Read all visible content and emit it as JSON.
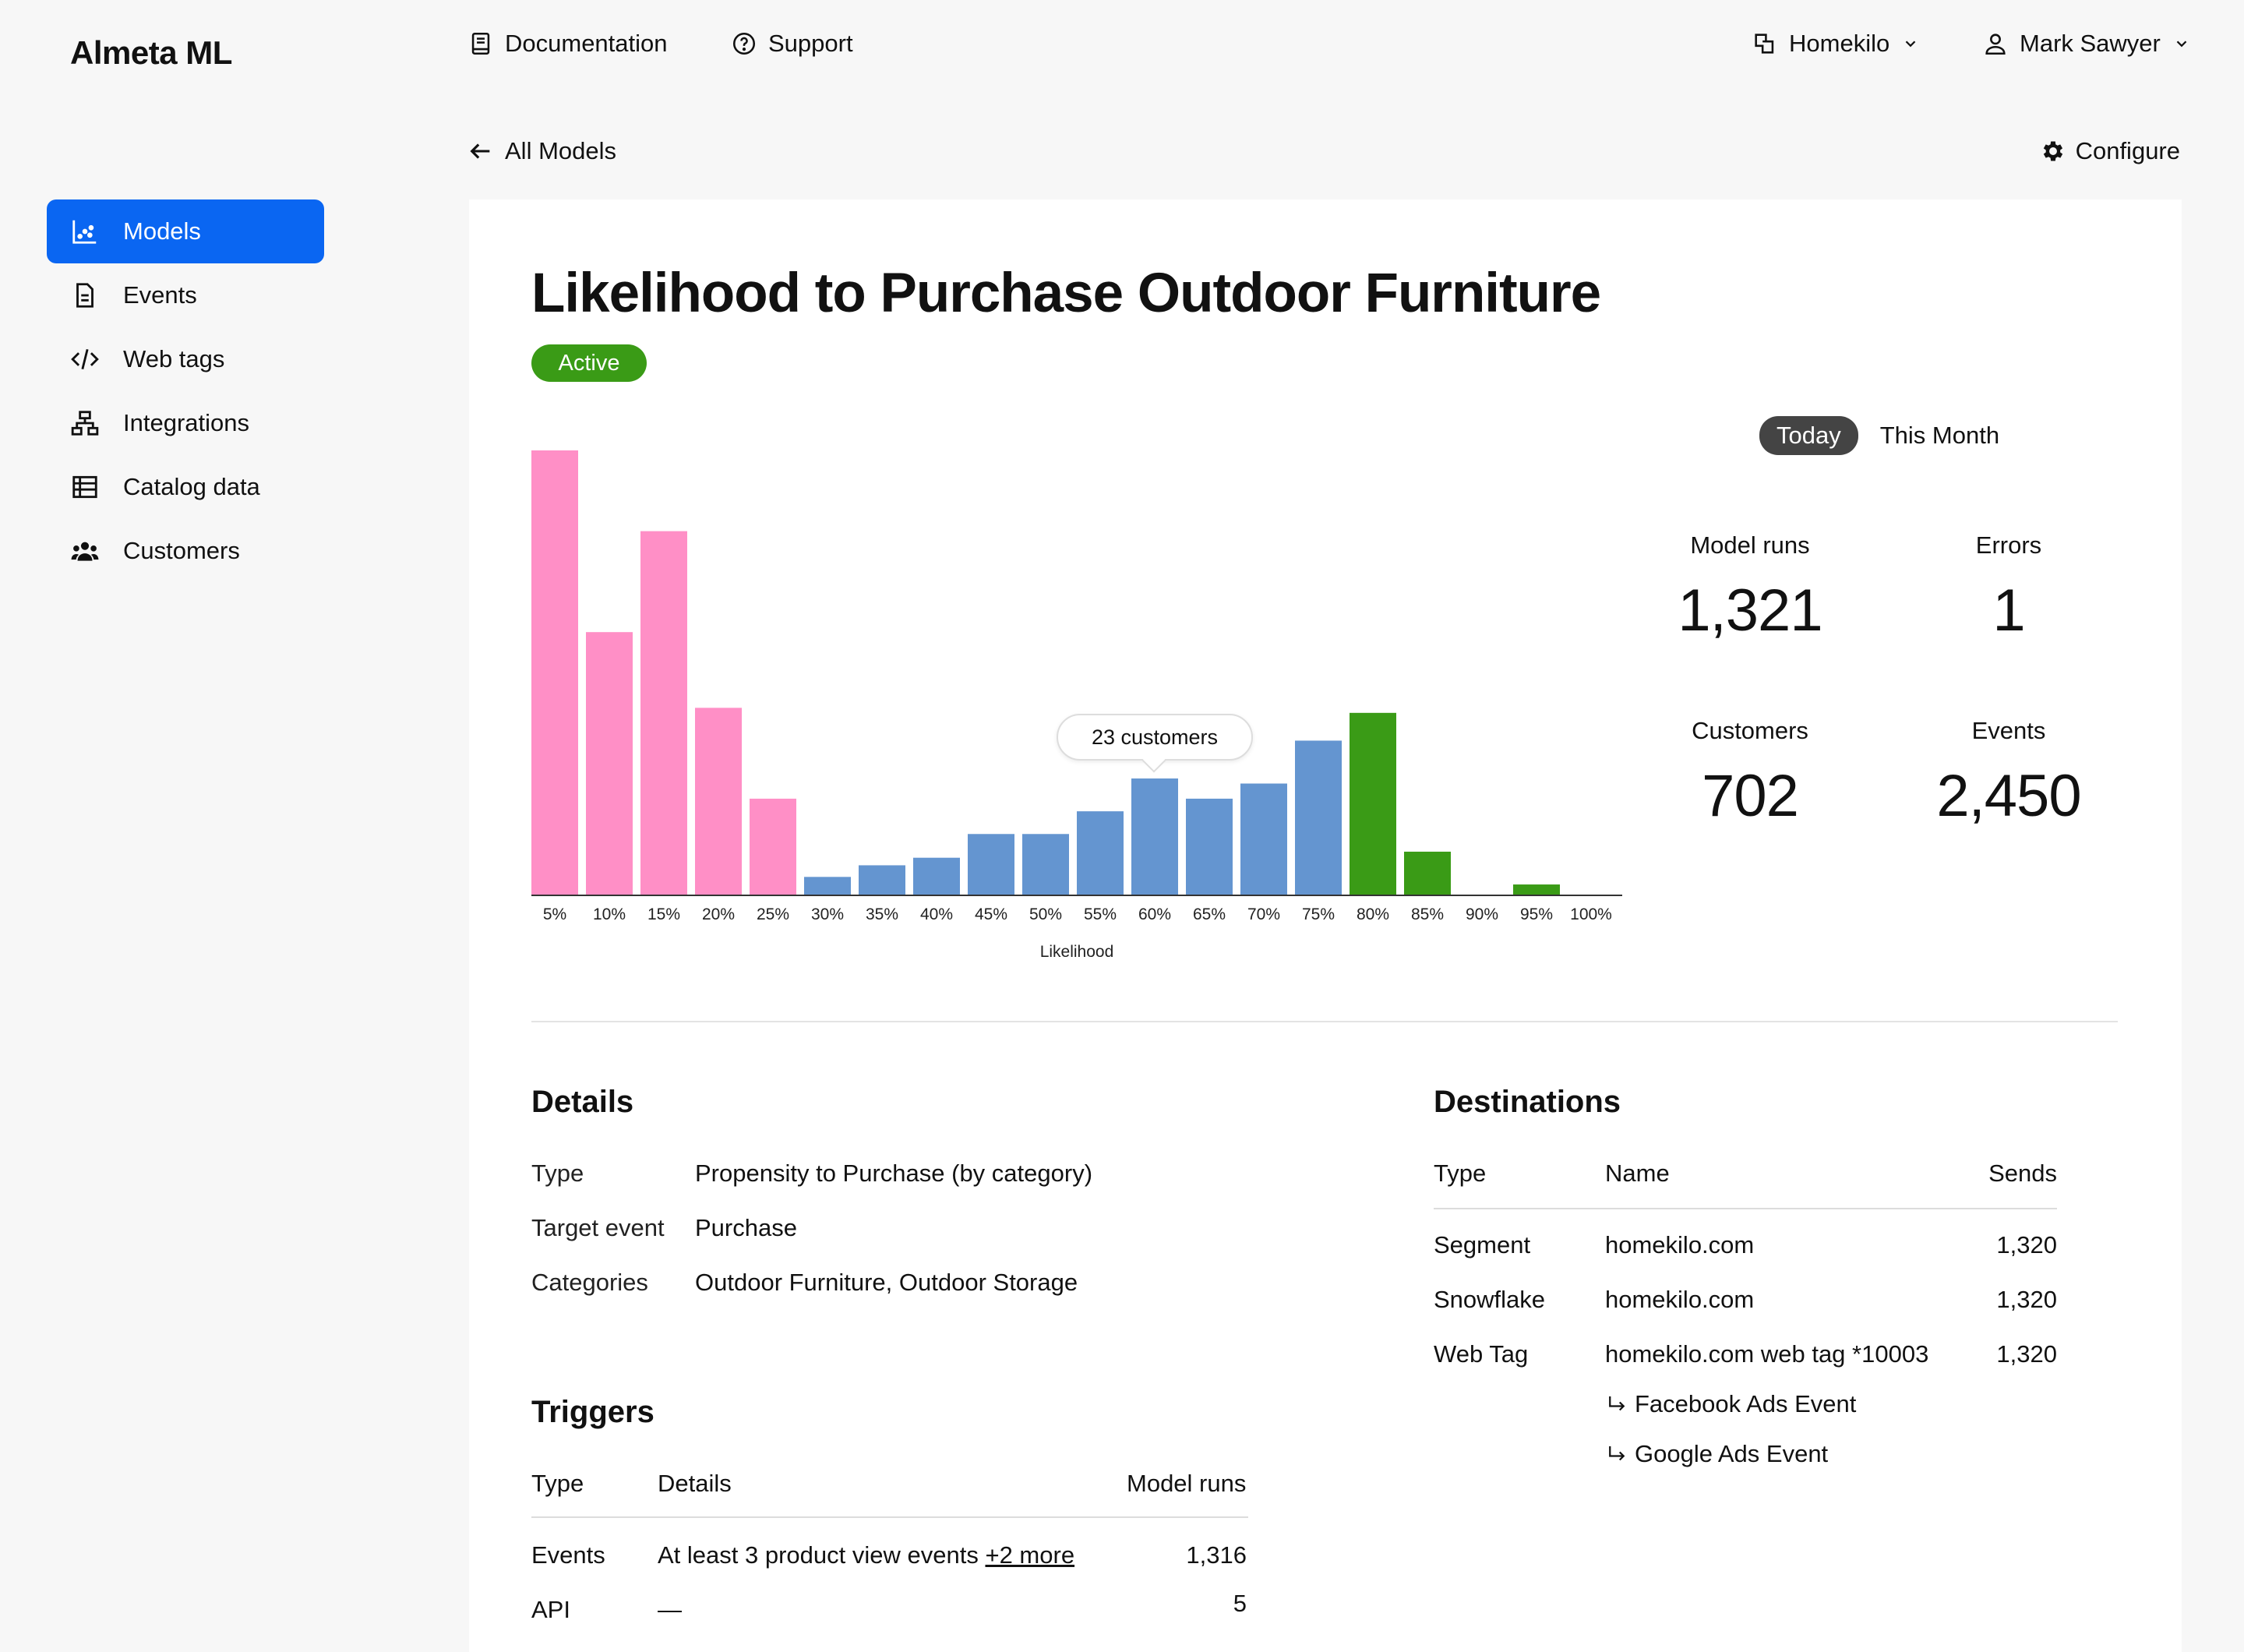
{
  "app": {
    "title": "Almeta ML"
  },
  "topnav": {
    "documentation": "Documentation",
    "support": "Support",
    "workspace": "Homekilo",
    "user": "Mark Sawyer"
  },
  "sidebar": {
    "items": [
      {
        "label": "Models",
        "icon": "chart-icon",
        "active": true
      },
      {
        "label": "Events",
        "icon": "document-icon"
      },
      {
        "label": "Web tags",
        "icon": "code-icon"
      },
      {
        "label": "Integrations",
        "icon": "network-icon"
      },
      {
        "label": "Catalog data",
        "icon": "table-icon"
      },
      {
        "label": "Customers",
        "icon": "users-icon"
      }
    ]
  },
  "header": {
    "back_label": "All Models",
    "configure_label": "Configure"
  },
  "model": {
    "title": "Likelihood to Purchase Outdoor Furniture",
    "status": "Active"
  },
  "colors": {
    "accent": "#0a66f2",
    "active": "#3a9b16",
    "pink": "#ff8fc6",
    "blue": "#6495d0",
    "green": "#3a9b16"
  },
  "chart_data": {
    "type": "bar",
    "xlabel": "Likelihood",
    "categories": [
      "5%",
      "10%",
      "15%",
      "20%",
      "25%",
      "30%",
      "35%",
      "40%",
      "45%",
      "50%",
      "55%",
      "60%",
      "65%",
      "70%",
      "75%",
      "80%",
      "85%",
      "90%",
      "95%",
      "100%"
    ],
    "values": [
      88,
      52,
      72,
      37,
      19,
      3.5,
      5.8,
      7.3,
      12,
      12,
      16.5,
      23,
      19,
      22,
      30.5,
      36,
      8.5,
      0,
      2,
      0
    ],
    "bar_groups": [
      "pink",
      "pink",
      "pink",
      "pink",
      "pink",
      "blue",
      "blue",
      "blue",
      "blue",
      "blue",
      "blue",
      "blue",
      "blue",
      "blue",
      "blue",
      "green",
      "green",
      "green",
      "green",
      "green"
    ],
    "tooltip": {
      "category": "60%",
      "label": "23 customers"
    }
  },
  "period": {
    "today": "Today",
    "month": "This Month"
  },
  "stats": {
    "model_runs_label": "Model runs",
    "model_runs": "1,321",
    "errors_label": "Errors",
    "errors": "1",
    "customers_label": "Customers",
    "customers": "702",
    "events_label": "Events",
    "events": "2,450"
  },
  "details": {
    "heading": "Details",
    "rows": [
      {
        "label": "Type",
        "value": "Propensity to Purchase (by category)"
      },
      {
        "label": "Target event",
        "value": "Purchase"
      },
      {
        "label": "Categories",
        "value": "Outdoor Furniture, Outdoor Storage"
      }
    ]
  },
  "triggers": {
    "heading": "Triggers",
    "columns": [
      "Type",
      "Details",
      "Model runs"
    ],
    "rows": [
      {
        "type": "Events",
        "details_prefix": "At least 3 ",
        "details_bold": "product view events",
        "details_more": "+2 more",
        "runs": "1,316"
      },
      {
        "type": "API",
        "details_prefix": "—",
        "details_bold": "",
        "details_more": "",
        "runs": "5"
      }
    ]
  },
  "destinations": {
    "heading": "Destinations",
    "columns": [
      "Type",
      "Name",
      "Sends"
    ],
    "rows": [
      {
        "type": "Segment",
        "name": "homekilo.com",
        "sends": "1,320"
      },
      {
        "type": "Snowflake",
        "name": "homekilo.com",
        "sends": "1,320"
      },
      {
        "type": "Web Tag",
        "name": "homekilo.com web tag *10003",
        "sends": "1,320"
      }
    ],
    "sub_events": [
      "Facebook Ads Event",
      "Google Ads Event"
    ]
  }
}
